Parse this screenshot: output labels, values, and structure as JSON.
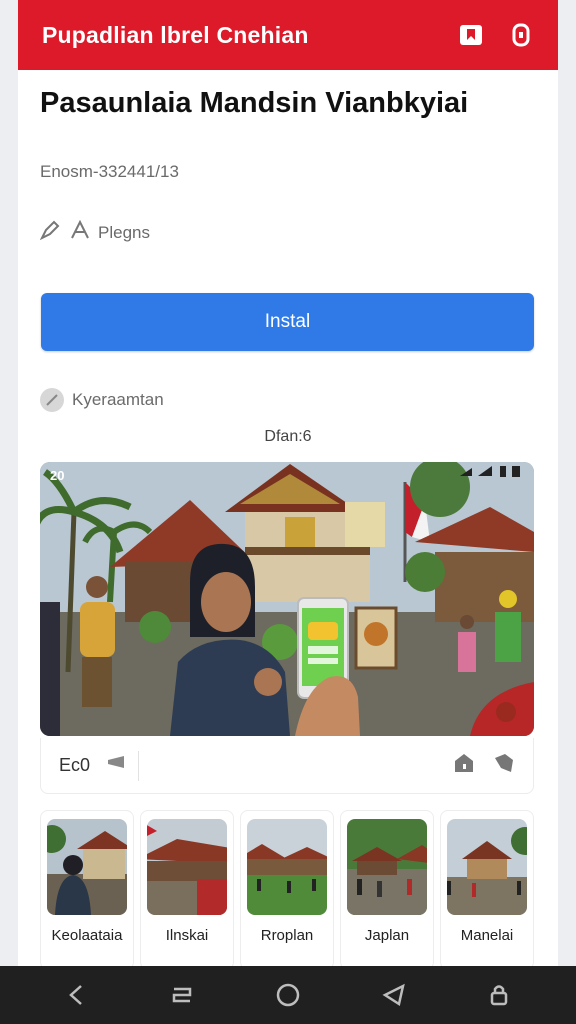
{
  "header": {
    "title": "Pupadlian lbrel Cnehian",
    "icons": [
      "bookmark-icon",
      "profile-icon"
    ]
  },
  "app": {
    "title": "Pasaunlaia Mandsin Vianbkyiai",
    "subtitle": "Enosm-332441/13",
    "publisher": "Plegns"
  },
  "install": {
    "label": "Instal"
  },
  "category": {
    "label": "Kyeraamtan"
  },
  "rating_label": "Dfan:6",
  "hero": {
    "badge": "20"
  },
  "actions": {
    "count": "Ec0"
  },
  "thumbnails": [
    {
      "label": "Keolaataia"
    },
    {
      "label": "Ilnskai"
    },
    {
      "label": "Rroplan"
    },
    {
      "label": "Japlan"
    },
    {
      "label": "Manelai"
    }
  ],
  "colors": {
    "header": "#dd1a2a",
    "install": "#2f7ae6",
    "navbar": "#202020"
  }
}
